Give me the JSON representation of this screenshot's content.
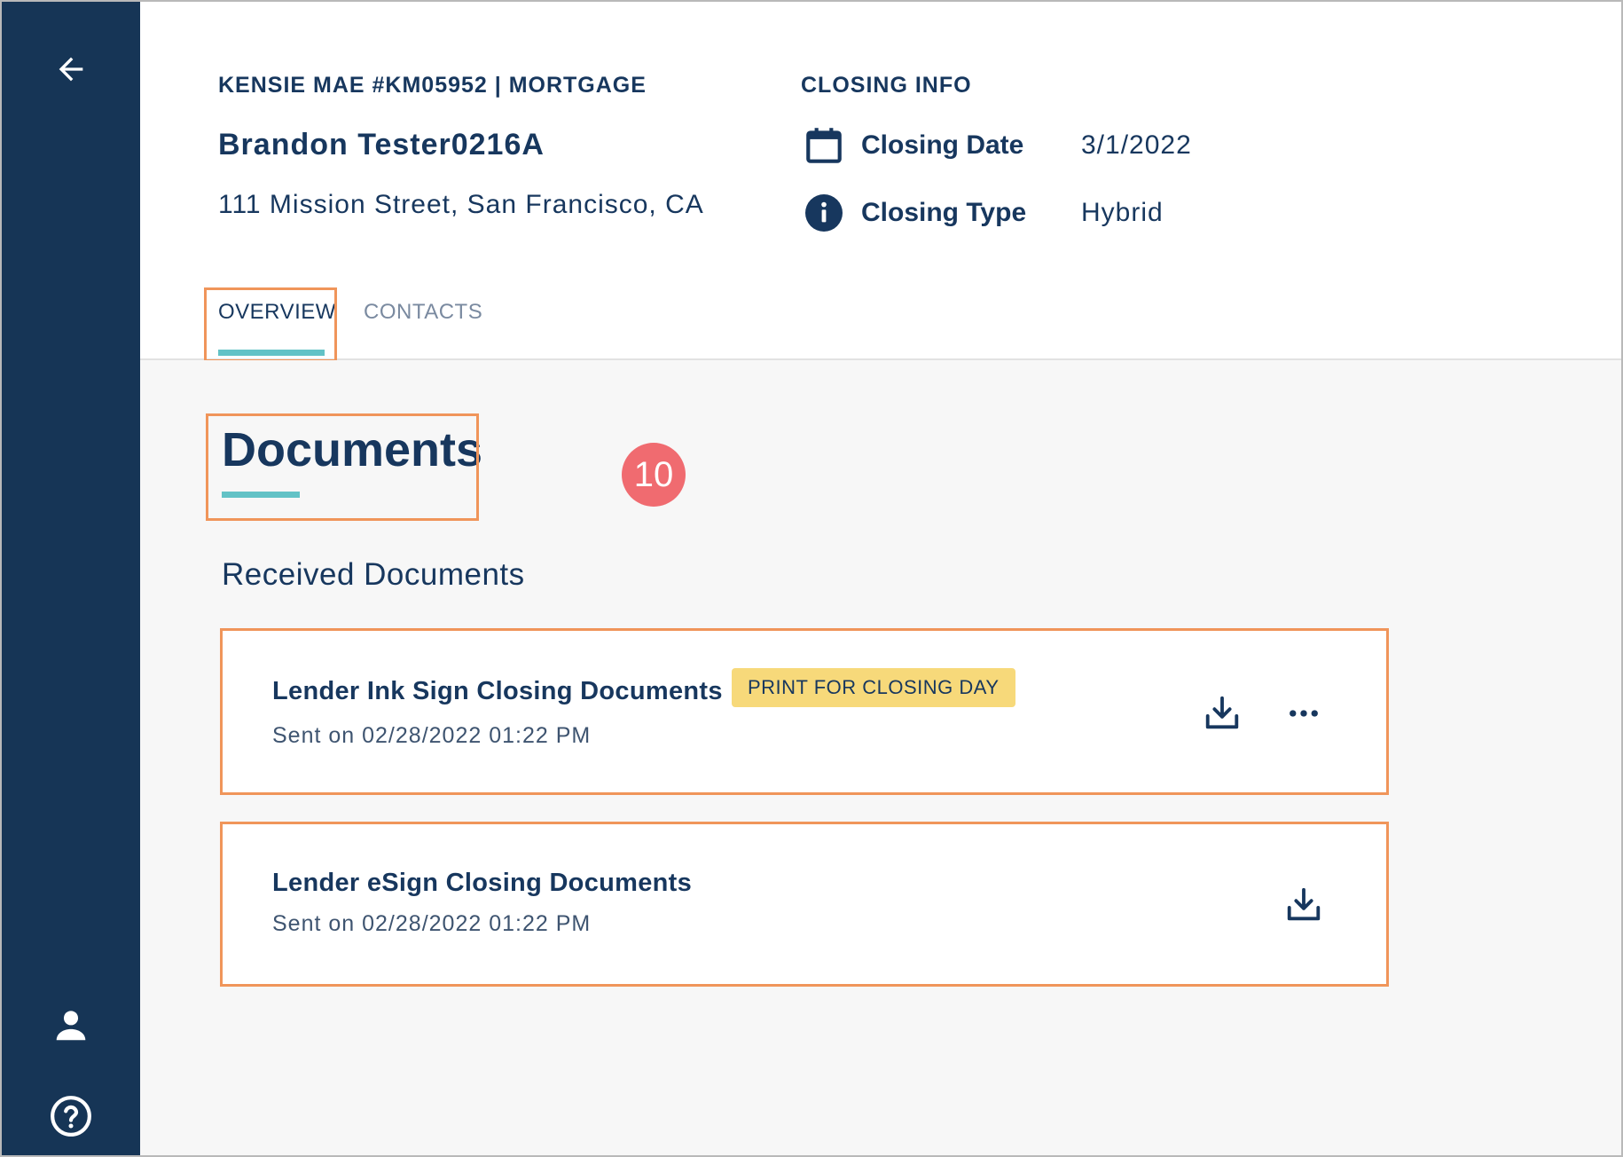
{
  "sidebar": {
    "icons": [
      "arrow-left-icon",
      "user-icon",
      "help-icon"
    ]
  },
  "header": {
    "loan_id": "KENSIE MAE #KM05952 | MORTGAGE",
    "borrower_name": "Brandon Tester0216A",
    "address": "111 Mission Street, San Francisco, CA",
    "closing_info": {
      "title": "CLOSING INFO",
      "rows": [
        {
          "icon": "calendar-icon",
          "label": "Closing Date",
          "value": "3/1/2022"
        },
        {
          "icon": "info-icon",
          "label": "Closing Type",
          "value": "Hybrid"
        }
      ]
    },
    "tabs": [
      {
        "label": "OVERVIEW",
        "active": true
      },
      {
        "label": "CONTACTS",
        "active": false
      }
    ]
  },
  "main": {
    "title": "Documents",
    "step_badge": "10",
    "section_title": "Received Documents",
    "documents": [
      {
        "name": "Lender Ink Sign Closing Documents",
        "sent": "Sent on 02/28/2022 01:22 PM",
        "badge": "PRINT FOR CLOSING DAY",
        "actions": [
          "download-icon",
          "more-horizontal-icon"
        ]
      },
      {
        "name": "Lender eSign Closing Documents",
        "sent": "Sent on 02/28/2022 01:22 PM",
        "actions": [
          "download-icon"
        ]
      }
    ]
  },
  "colors": {
    "sidebar": "#163556",
    "text": "#17375e",
    "accent_teal": "#63c2c6",
    "highlight_orange": "#f0955a",
    "step_badge": "#f06b70",
    "badge_yellow": "#f7d97a",
    "main_bg": "#f7f7f7"
  }
}
